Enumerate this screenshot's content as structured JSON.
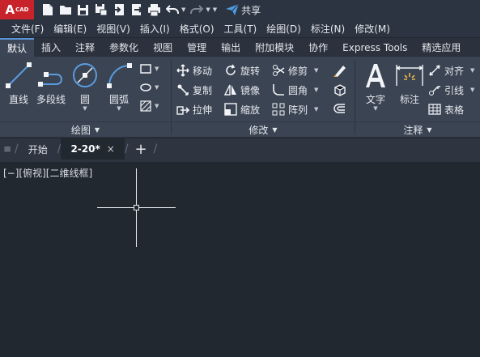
{
  "app": {
    "logo_big": "A",
    "logo_small": "CAD",
    "share_label": "共享"
  },
  "menu": [
    "文件(F)",
    "编辑(E)",
    "视图(V)",
    "插入(I)",
    "格式(O)",
    "工具(T)",
    "绘图(D)",
    "标注(N)",
    "修改(M)"
  ],
  "ribbon_tabs": [
    "默认",
    "插入",
    "注释",
    "参数化",
    "视图",
    "管理",
    "输出",
    "附加模块",
    "协作",
    "Express Tools",
    "精选应用"
  ],
  "active_ribbon_tab": "默认",
  "draw_panel": {
    "title": "绘图",
    "line": "直线",
    "polyline": "多段线",
    "circle": "圆",
    "arc": "圆弧"
  },
  "modify_panel": {
    "title": "修改",
    "move": "移动",
    "rotate": "旋转",
    "trim": "修剪",
    "copy": "复制",
    "mirror": "镜像",
    "fillet": "圆角",
    "stretch": "拉伸",
    "scale": "缩放",
    "array": "阵列"
  },
  "annotation_panel": {
    "title": "注释",
    "text": "文字",
    "dimension": "标注",
    "align": "对齐",
    "leader": "引线",
    "table": "表格"
  },
  "file_tabs": {
    "start": "开始",
    "drawing": "2-20*",
    "close": "×",
    "add": "+"
  },
  "viewport": {
    "label": "[−][俯视][二维线框]"
  },
  "colors": {
    "accent": "#5a95d8",
    "logo": "#c8222a",
    "canvas": "#212830",
    "ribbon": "#3b4453"
  }
}
